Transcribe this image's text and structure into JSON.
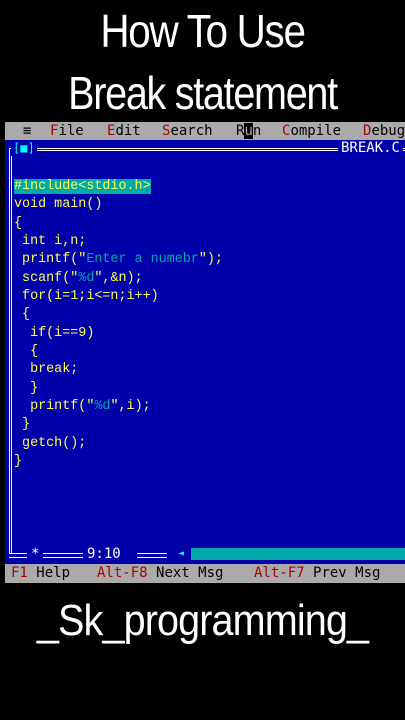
{
  "heading": {
    "line1": "How To Use",
    "line2": "Break statement"
  },
  "menu": {
    "system": "≡",
    "items": [
      {
        "hotkey": "F",
        "rest": "ile"
      },
      {
        "hotkey": "E",
        "rest": "dit"
      },
      {
        "hotkey": "S",
        "rest": "earch"
      },
      {
        "pre": "R",
        "hotkey": "u",
        "rest": "n"
      },
      {
        "hotkey": "C",
        "rest": "ompile"
      },
      {
        "hotkey": "D",
        "rest": "ebug"
      }
    ]
  },
  "editor": {
    "window_button": "[■]",
    "filename": "BREAK.C",
    "code_lines": [
      "#include<stdio.h>",
      "void main()",
      "{",
      " int i,n;",
      " printf(\"Enter a numebr\");",
      " scanf(\"%d\",&n);",
      " for(i=1;i<=n;i++)",
      " {",
      "  if(i==9)",
      "  {",
      "  break;",
      "  }",
      "  printf(\"%d\",i);",
      " }",
      " getch();",
      "}"
    ],
    "cursor_position": "9:10",
    "status_marker": "*"
  },
  "helpbar": [
    {
      "key": "F1",
      "label": "Help"
    },
    {
      "key": "Alt-F8",
      "label": "Next Msg"
    },
    {
      "key": "Alt-F7",
      "label": "Prev Msg"
    }
  ],
  "brand": "_Sk_programming_",
  "colors": {
    "background": "#000000",
    "editor_bg": "#0000aa",
    "code_text": "#ffff55",
    "string_text": "#00aaaa",
    "menu_bg": "#aaaaaa",
    "hotkey": "#aa0000"
  }
}
